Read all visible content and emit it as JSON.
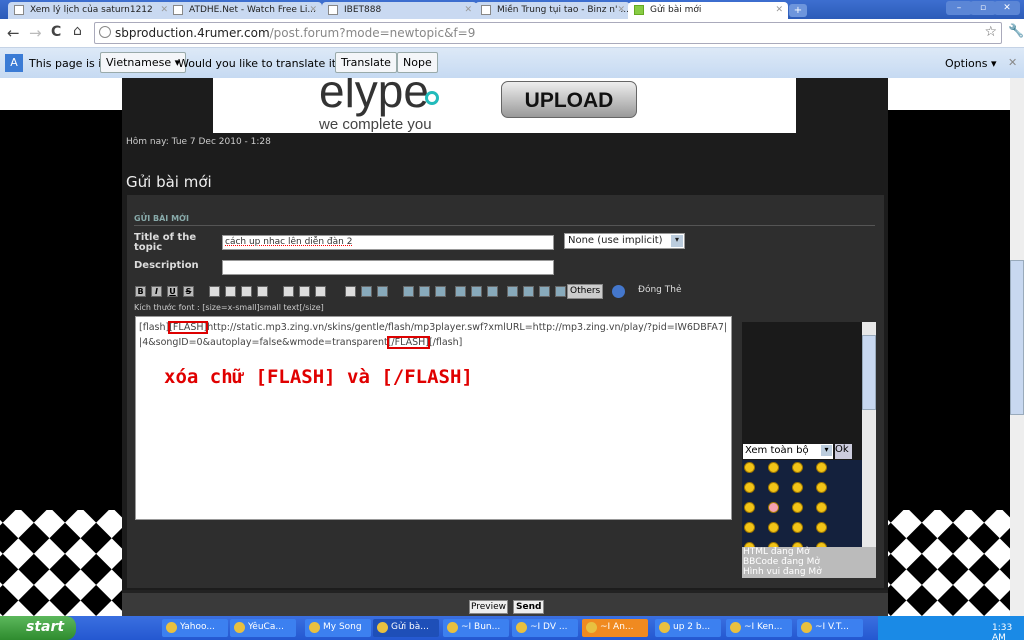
{
  "browser": {
    "tabs": [
      {
        "label": "Xem lý lịch của saturn1212"
      },
      {
        "label": "ATDHE.Net - Watch Free Li..."
      },
      {
        "label": "IBET888"
      },
      {
        "label": "Miền Trung tụi tao - Binz n' ..."
      },
      {
        "label": "Gửi bài mới",
        "active": true
      }
    ],
    "url_host": "sbproduction.4rumer.com",
    "url_path": "/post.forum?mode=newtopic&f=9",
    "translate": {
      "prefix": "This page is in",
      "language": "Vietnamese ▾",
      "question": "Would you like to translate it?",
      "translate": "Translate",
      "nope": "Nope",
      "options": "Options ▾",
      "close": "✕"
    }
  },
  "banner": {
    "brand": "elype",
    "tagline": "we complete you",
    "upload": "UPLOAD"
  },
  "date": "Hôm nay: Tue 7 Dec 2010 - 1:28",
  "heading": "Gửi bài mới",
  "form": {
    "section": "GỬI BÀI MỚI",
    "title_label": "Title of the topic",
    "title_value": "cách up nhac lên diễn đàn 2",
    "icon_select": "None (use implicit)",
    "description_label": "Description",
    "description_value": "",
    "toolbar": {
      "bold": "B",
      "italic": "I",
      "underline": "U",
      "strike": "S",
      "others": "Others",
      "close_tags": "Đóng Thẻ"
    },
    "font_hint": "Kích thước font : [size=x-small]small text[/size]",
    "body_parts": [
      "[flash]",
      "[FLASH]",
      "http://static.mp3.zing.vn/skins/gentle/flash/mp3player.swf?xmlURL=http://mp3.zing.vn/play/?pid=IW6DBFA7||4&songID=0&autoplay=false&wmode=transparent",
      "[/FLASH]",
      "[/flash]"
    ],
    "annotation": "xóa chữ [FLASH] và [/FLASH]",
    "annotation_color": "#e00000",
    "smiley_select": "Xem toàn bộ",
    "smiley_ok": "Ok",
    "status": [
      "HTML đang Mở",
      "BBCode đang Mở",
      "Hình vui đang Mở"
    ],
    "preview": "Preview",
    "send": "Send"
  },
  "taskbar": {
    "start": "start",
    "items": [
      "Yahoo...",
      "YêuCa...",
      "My Song",
      "Gửi bà...",
      "~I Bun...",
      "~I DV ...",
      "~I An...",
      "up 2 b...",
      "~I Ken...",
      "~I V.T..."
    ],
    "clock": "1:33 AM"
  }
}
